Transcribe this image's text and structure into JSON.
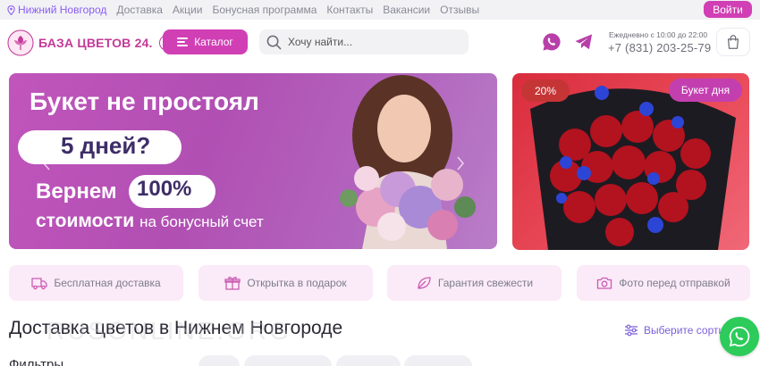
{
  "topnav": {
    "city": "Нижний Новгород",
    "links": [
      "Доставка",
      "Акции",
      "Бонусная программа",
      "Контакты",
      "Вакансии",
      "Отзывы"
    ],
    "login_label": "Войти"
  },
  "header": {
    "logo_text": "БАЗА ЦВЕТОВ 24.",
    "logo_suffix": "ру",
    "catalog_label": "Каталог",
    "search_placeholder": "Хочу найти...",
    "hours": "Ежедневно с 10:00 до 22:00",
    "phone": "+7 (831) 203-25-79"
  },
  "hero": {
    "line1": "Букет не простоял",
    "line2": "5 дней?",
    "line3": "Вернем",
    "line3_value": "100%",
    "line4": "стоимости",
    "line4_small": "на бонусный счет"
  },
  "product_card": {
    "discount_badge": "20%",
    "tag_badge": "Букет дня"
  },
  "benefits": [
    {
      "label": "Бесплатная доставка",
      "icon": "truck-icon"
    },
    {
      "label": "Открытка в подарок",
      "icon": "gift-icon"
    },
    {
      "label": "Гарантия свежести",
      "icon": "leaf-icon"
    },
    {
      "label": "Фото перед отправкой",
      "icon": "camera-icon"
    }
  ],
  "catalog": {
    "title": "Доставка цветов в Нижнем Новгороде",
    "sort_label": "Выберите сортир",
    "filters_label": "Фильтры"
  },
  "watermark": "RUSONLINE.ORG",
  "colors": {
    "accent": "#d13fb5",
    "violet": "#7c60d9",
    "whatsapp": "#2ccb5a",
    "telegram": "#b83fa8"
  }
}
